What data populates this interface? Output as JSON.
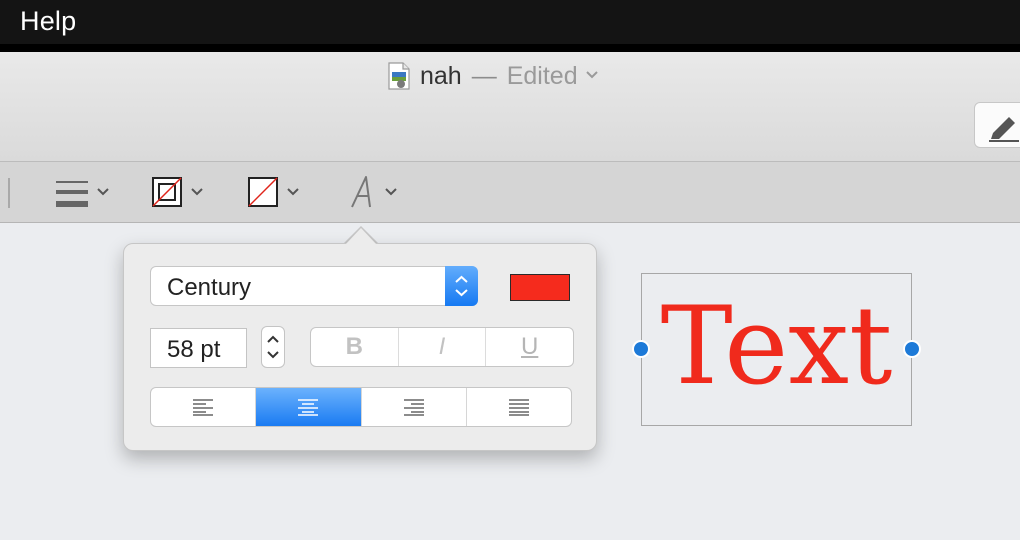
{
  "menubar": {
    "help_label": "Help"
  },
  "window": {
    "title": "nah",
    "separator": "—",
    "status": "Edited"
  },
  "toolbar": {
    "tools": [
      {
        "name": "line-style",
        "icon": "lines-icon"
      },
      {
        "name": "border-color",
        "icon": "shape-border-icon"
      },
      {
        "name": "fill-color",
        "icon": "fill-none-icon"
      },
      {
        "name": "text-style",
        "icon": "font-a-icon"
      }
    ]
  },
  "font_popover": {
    "font_name": "Century",
    "font_size": "58 pt",
    "color": "#f52b1d",
    "bold_label": "B",
    "italic_label": "I",
    "underline_label": "U",
    "alignment_options": [
      "left",
      "center",
      "right",
      "justify"
    ],
    "selected_alignment": "center"
  },
  "canvas": {
    "text": "Text",
    "text_color": "#f02a1c"
  }
}
